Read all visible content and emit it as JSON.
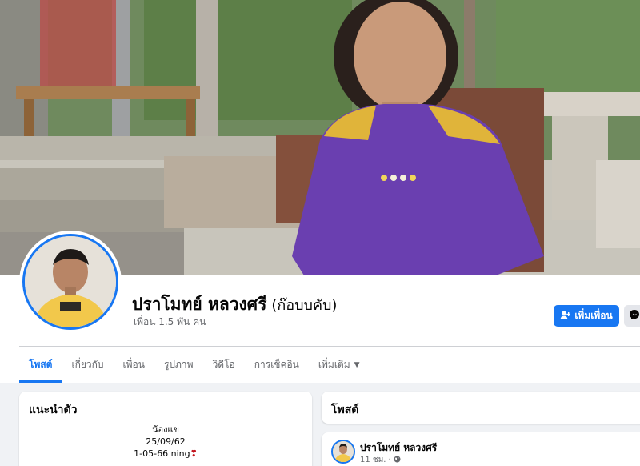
{
  "profile": {
    "name": "ปราโมทย์ หลวงศรี",
    "alternate_name": "(ก๊อบบคับ)",
    "friends_count": "เพื่อน 1.5 พัน คน"
  },
  "actions": {
    "add_friend": "เพิ่มเพื่อน"
  },
  "tabs": [
    {
      "label": "โพสต์"
    },
    {
      "label": "เกี่ยวกับ"
    },
    {
      "label": "เพื่อน"
    },
    {
      "label": "รูปภาพ"
    },
    {
      "label": "วิดีโอ"
    },
    {
      "label": "การเช็คอิน"
    },
    {
      "label": "เพิ่มเติม"
    }
  ],
  "intro": {
    "title": "แนะนำตัว",
    "bio_lines": [
      "น้องแข",
      "25/09/62",
      "1-05-66 ning"
    ]
  },
  "posts": {
    "title": "โพสต์",
    "first_post": {
      "author": "ปราโมทย์ หลวงศรี",
      "time": "11 ชม.",
      "separator": "·"
    }
  },
  "colors": {
    "accent": "#1877f2",
    "background": "#f0f2f5",
    "muted_text": "#65676b"
  },
  "icons": {
    "add_friend": "user-plus-icon",
    "messenger": "messenger-icon",
    "privacy": "globe-icon",
    "heart": "heart-icon"
  }
}
